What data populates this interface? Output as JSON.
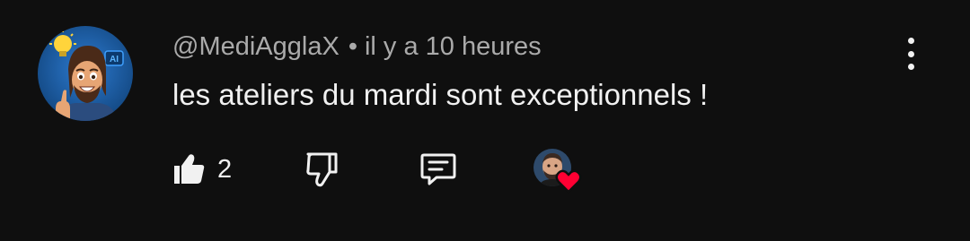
{
  "comment": {
    "author": "@MediAgglaX",
    "separator": "•",
    "time": "il y a 10 heures",
    "text": "les ateliers du mardi sont exceptionnels !",
    "likes": "2"
  },
  "icons": {
    "like": "thumb-up-icon",
    "dislike": "thumb-down-icon",
    "reply": "comment-icon",
    "more": "more-vertical-icon",
    "creator_heart": "heart-icon"
  },
  "colors": {
    "background": "#0f0f0f",
    "text_primary": "#f1f1f1",
    "text_secondary": "#aaaaaa",
    "heart": "#ff0033",
    "avatar_bg": "#1f5ea8"
  }
}
